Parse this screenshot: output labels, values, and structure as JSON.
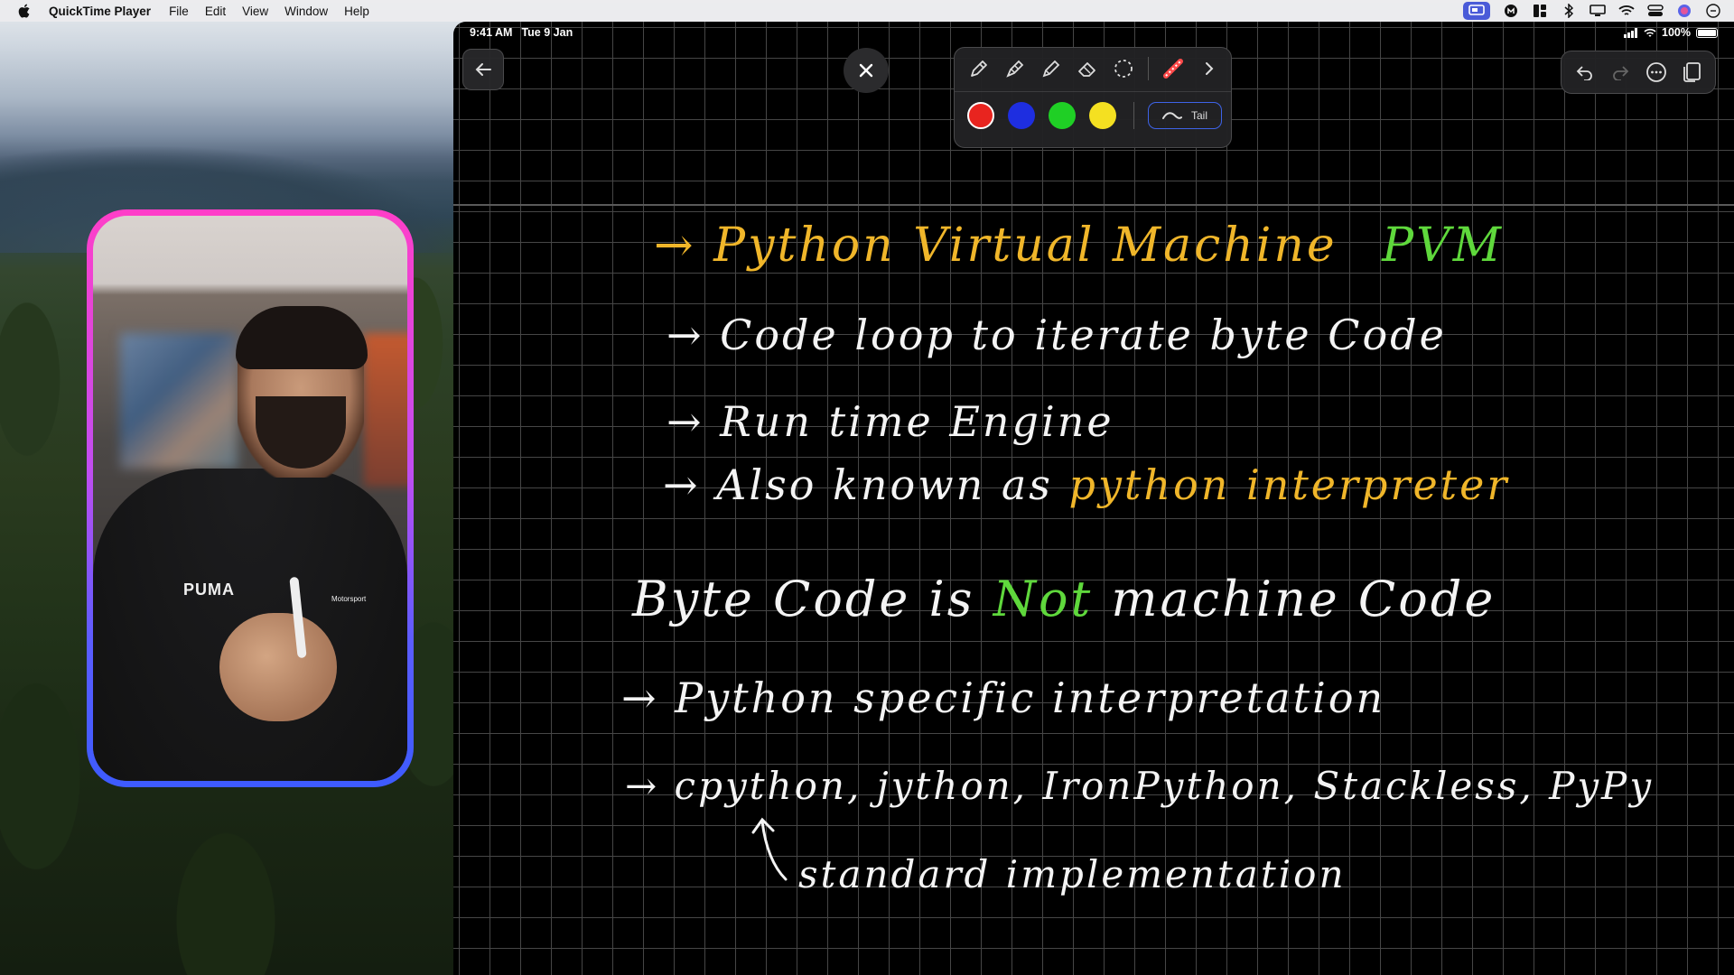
{
  "menubar": {
    "app_name": "QuickTime Player",
    "menus": [
      "File",
      "Edit",
      "View",
      "Window",
      "Help"
    ]
  },
  "ipad": {
    "status": {
      "time": "9:41 AM",
      "date": "Tue 9 Jan",
      "battery": "100%"
    },
    "toolbar": {
      "tools": [
        "pen-tool",
        "marker-tool",
        "highlighter-tool",
        "eraser-tool",
        "lasso-tool",
        "ruler-tool"
      ],
      "colors": [
        "#e8241f",
        "#1e2ee0",
        "#1fcf25",
        "#f4e021"
      ],
      "selected_color_index": 0,
      "tail_label": "Tail"
    },
    "notes": {
      "line1": {
        "arrow": "→",
        "yellow": "Python Virtual Machine",
        "green": "PVM"
      },
      "line2": "→ Code loop to iterate byte Code",
      "line3": "→ Run time Engine",
      "line4": {
        "white": "→ Also known as",
        "yellow": "python interpreter"
      },
      "line5": {
        "white_a": "Byte Code is",
        "green": "Not",
        "white_b": "machine Code"
      },
      "line6": "→ Python specific interpretation",
      "line7": "→ cpython, jython, IronPython, Stackless, PyPy",
      "line8": "standard implementation"
    }
  },
  "camera": {
    "shirt_brand": "PUMA",
    "badge_text": "Motorsport"
  }
}
